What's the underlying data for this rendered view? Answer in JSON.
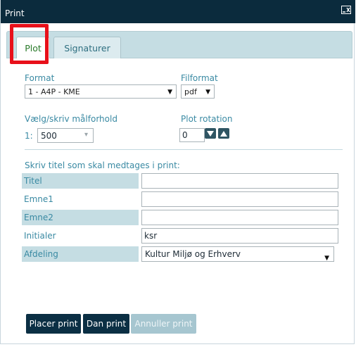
{
  "window": {
    "title": "Print",
    "icon": "minimize-close-icon"
  },
  "tabs": [
    {
      "label": "Plot",
      "active": true
    },
    {
      "label": "Signaturer",
      "active": false
    }
  ],
  "format": {
    "label": "Format",
    "value": "1 - A4P - KME"
  },
  "filformat": {
    "label": "Filformat",
    "value": "pdf"
  },
  "scale": {
    "label": "Vælg/skriv målforhold",
    "prefix": "1:",
    "value": "500"
  },
  "rotation": {
    "label": "Plot rotation",
    "value": "0"
  },
  "fields": {
    "heading": "Skriv titel som skal medtages i print:",
    "titel": {
      "label": "Titel",
      "value": ""
    },
    "emne1": {
      "label": "Emne1",
      "value": ""
    },
    "emne2": {
      "label": "Emne2",
      "value": ""
    },
    "initialer": {
      "label": "Initialer",
      "value": "ksr"
    },
    "afdeling": {
      "label": "Afdeling",
      "value": "Kultur Miljø og Erhverv"
    }
  },
  "buttons": {
    "placer": "Placer print",
    "dan": "Dan print",
    "annuller": "Annuller print"
  },
  "colors": {
    "titlebar": "#0b2b3d",
    "accent": "#3a8aa3",
    "highlight": "#e8101a",
    "button": "#0b2f44",
    "button_disabled": "#a6c6d0"
  }
}
